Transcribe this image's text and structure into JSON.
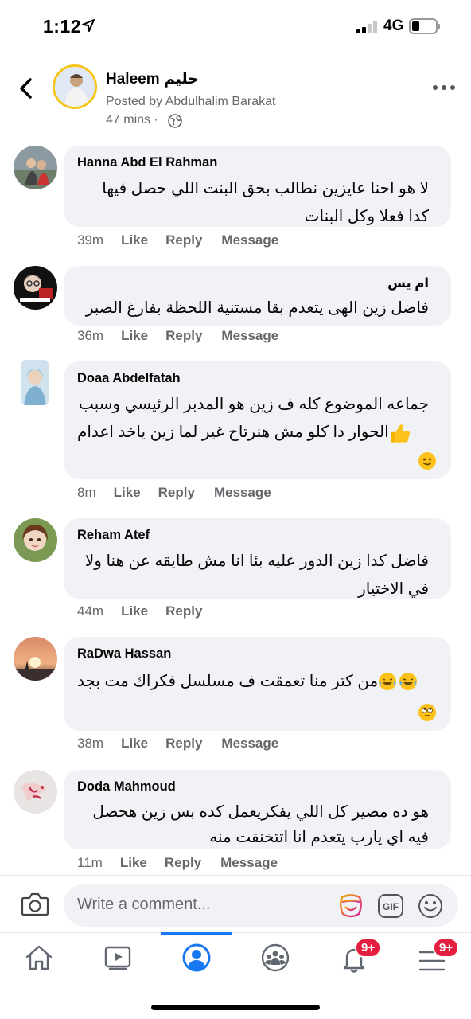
{
  "status": {
    "time": "1:12",
    "network": "4G"
  },
  "post": {
    "page_name": "Haleem حليم",
    "posted_by": "Posted by Abdulhalim Barakat",
    "time": "47 mins ·"
  },
  "comments": [
    {
      "name": "Hanna Abd El Rahman",
      "lines": [
        "لا هو احنا عايزين نطالب بحق البنت اللي حصل فيها",
        "كدا فعلا وكل البنات"
      ],
      "time": "39m",
      "like": "Like",
      "reply": "Reply",
      "message": "Message"
    },
    {
      "name": "ام يس",
      "lines": [
        "فاضل زين الهى يتعدم بقا مستنية اللحظة بفارغ الصبر"
      ],
      "time": "36m",
      "like": "Like",
      "reply": "Reply",
      "message": "Message"
    },
    {
      "name": "Doaa Abdelfatah",
      "lines": [
        "جماعه الموضوع كله ف زين هو المدبر الرئيسي وسبب",
        "الحوار دا كلو مش هنرتاح غير لما زين ياخد اعدام"
      ],
      "time": "8m",
      "like": "Like",
      "reply": "Reply",
      "message": "Message"
    },
    {
      "name": "Reham Atef",
      "lines": [
        "فاضل كدا زين الدور عليه بئا انا مش طايقه عن هنا ولا",
        "في الاختيار"
      ],
      "time": "44m",
      "like": "Like",
      "reply": "Reply"
    },
    {
      "name": "RaDwa Hassan",
      "lines": [
        "من كتر منا تعمقت ف مسلسل فكراك مت بجد"
      ],
      "time": "38m",
      "like": "Like",
      "reply": "Reply",
      "message": "Message"
    },
    {
      "name": "Doda Mahmoud",
      "lines": [
        "هو ده مصير كل اللي يفكريعمل كده بس زين هحصل",
        "فيه اي يارب يتعدم انا اتتخنقت منه"
      ],
      "time": "11m",
      "like": "Like",
      "reply": "Reply",
      "message": "Message"
    }
  ],
  "composer": {
    "placeholder": "Write a comment..."
  },
  "tabs": {
    "notifications_badge": "9+",
    "menu_badge": "9+",
    "accent": "#1877f2"
  }
}
